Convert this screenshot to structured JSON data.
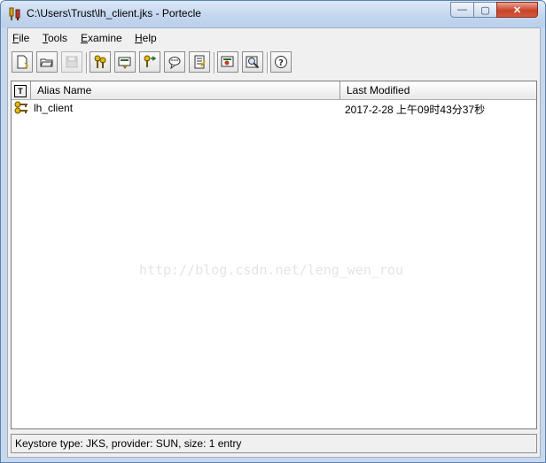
{
  "window": {
    "title": "C:\\Users\\Trust\\lh_client.jks - Portecle",
    "app_icon": "portecle-keys-icon",
    "controls": {
      "minimize": "—",
      "maximize": "▢",
      "close": "✕"
    }
  },
  "menu": {
    "items": [
      {
        "mnemonic": "F",
        "rest": "ile"
      },
      {
        "mnemonic": "T",
        "rest": "ools"
      },
      {
        "mnemonic": "E",
        "rest": "xamine"
      },
      {
        "mnemonic": "H",
        "rest": "elp"
      }
    ]
  },
  "toolbar": {
    "buttons": [
      {
        "icon": "new-keystore-icon"
      },
      {
        "icon": "open-keystore-icon"
      },
      {
        "icon": "save-keystore-icon",
        "disabled": true
      },
      {
        "icon": "generate-key-pair-icon"
      },
      {
        "icon": "import-certificate-icon"
      },
      {
        "icon": "import-key-pair-icon"
      },
      {
        "icon": "set-password-icon"
      },
      {
        "icon": "keystore-report-icon"
      },
      {
        "icon": "examine-certificate-icon"
      },
      {
        "icon": "examine-ssl-icon"
      },
      {
        "icon": "help-icon"
      }
    ]
  },
  "table": {
    "columns": {
      "type": "T",
      "alias": "Alias Name",
      "modified": "Last Modified"
    },
    "rows": [
      {
        "type_icon": "key-pair-icon",
        "alias": "lh_client",
        "modified": "2017-2-28 上午09时43分37秒"
      }
    ]
  },
  "watermark": "http://blog.csdn.net/leng_wen_rou",
  "status": "Keystore type: JKS, provider: SUN, size: 1 entry"
}
